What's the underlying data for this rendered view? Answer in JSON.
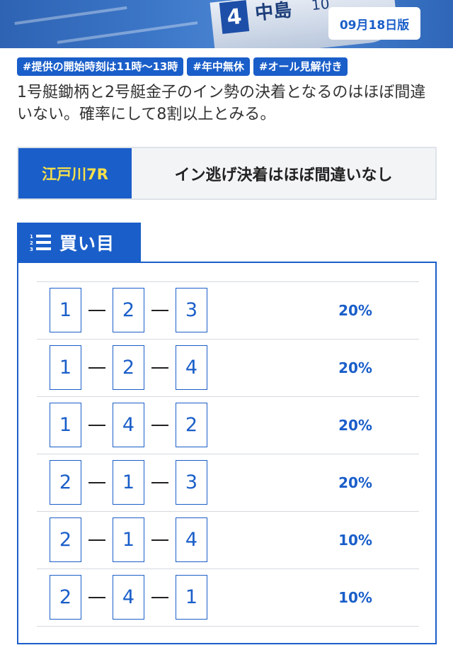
{
  "hero": {
    "boat_number": "4",
    "boat_name": "中島",
    "boat_number_partial": "10"
  },
  "edition_badge": "09月18日版",
  "tags": [
    "#提供の開始時刻は11時〜13時",
    "#年中無休",
    "#オール見解付き"
  ],
  "description": "1号艇鋤柄と2号艇金子のイン勢の決着となるのはほぼ間違いない。確率にして8割以上とみる。",
  "race": {
    "name": "江戸川7R",
    "headline": "イン逃げ決着はほぼ間違いなし"
  },
  "kaime": {
    "title": "買い目",
    "bets": [
      {
        "first": "1",
        "second": "2",
        "third": "3",
        "percent": "20%"
      },
      {
        "first": "1",
        "second": "2",
        "third": "4",
        "percent": "20%"
      },
      {
        "first": "1",
        "second": "4",
        "third": "2",
        "percent": "20%"
      },
      {
        "first": "2",
        "second": "1",
        "third": "3",
        "percent": "20%"
      },
      {
        "first": "2",
        "second": "1",
        "third": "4",
        "percent": "10%"
      },
      {
        "first": "2",
        "second": "4",
        "third": "1",
        "percent": "10%"
      }
    ]
  },
  "colors": {
    "accent": "#1a5ec9",
    "race_name_text": "#f7e04a",
    "panel_bg": "#f3f4f6"
  }
}
